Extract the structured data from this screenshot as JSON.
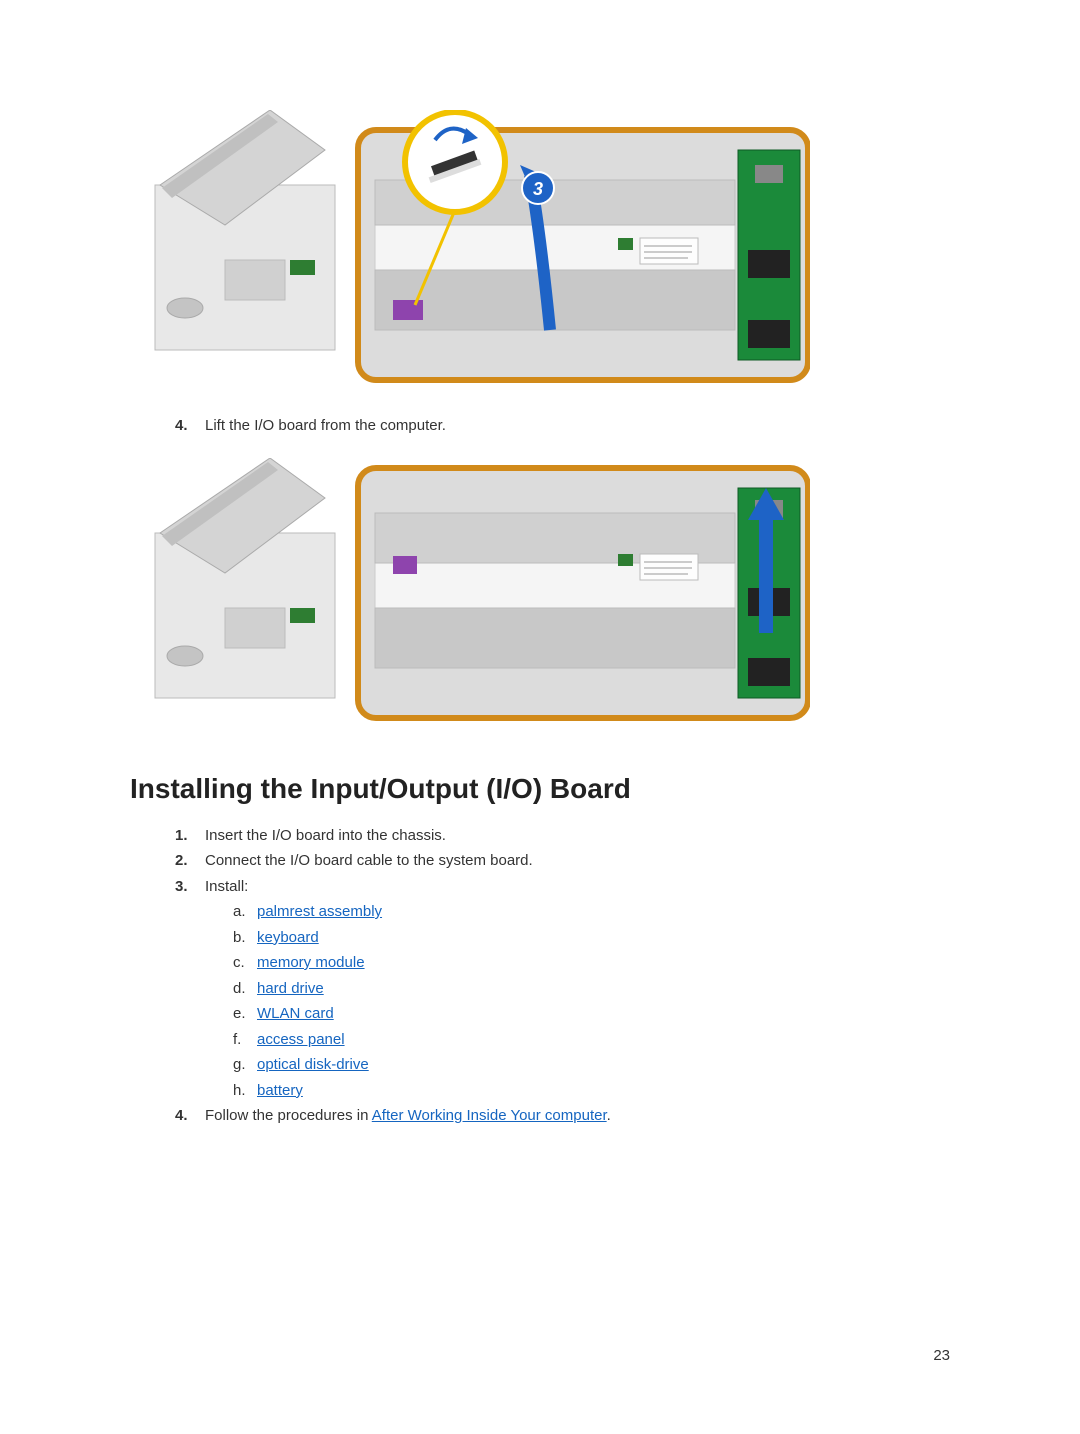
{
  "removing": {
    "step4": {
      "num": "4.",
      "text": "Lift the I/O board from the computer."
    }
  },
  "heading": "Installing the Input/Output (I/O) Board",
  "steps": {
    "s1": {
      "num": "1.",
      "text": "Insert the I/O board into the chassis."
    },
    "s2": {
      "num": "2.",
      "text": "Connect the I/O board cable to the system board."
    },
    "s3": {
      "num": "3.",
      "text": "Install:"
    },
    "s4": {
      "num": "4.",
      "prefix": "Follow the procedures in ",
      "link": "After Working Inside Your computer",
      "suffix": "."
    }
  },
  "sub": {
    "a": {
      "let": "a.",
      "link": "palmrest assembly"
    },
    "b": {
      "let": "b.",
      "link": "keyboard"
    },
    "c": {
      "let": "c.",
      "link": "memory module"
    },
    "d": {
      "let": "d.",
      "link": "hard drive"
    },
    "e": {
      "let": "e.",
      "link": "WLAN card"
    },
    "f": {
      "let": "f.",
      "link": "access panel"
    },
    "g": {
      "let": "g.",
      "link": "optical disk-drive"
    },
    "h": {
      "let": "h.",
      "link": "battery"
    }
  },
  "pagenum": "23"
}
